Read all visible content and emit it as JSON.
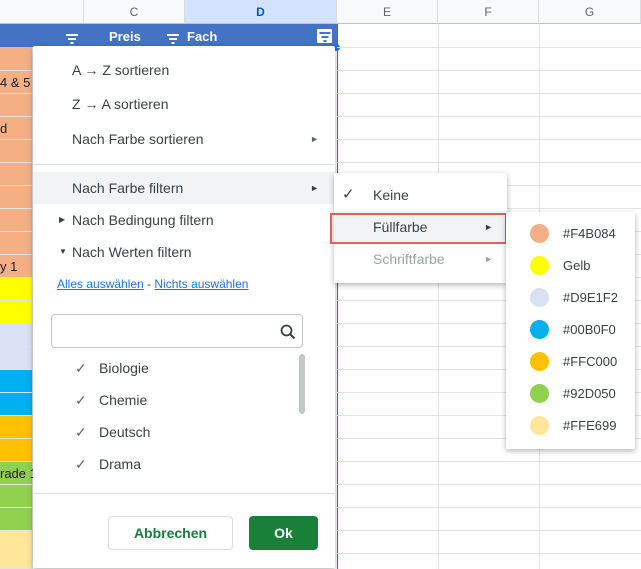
{
  "columns": {
    "c": "C",
    "d": "D",
    "e": "E",
    "f": "F",
    "g": "G"
  },
  "header_row": {
    "preis": "Preis",
    "fach": "Fach"
  },
  "left_cells": [
    "4 & 5",
    "d",
    "y 1",
    "rade 1"
  ],
  "menu": {
    "sort_az": "A → Z sortieren",
    "sort_za": "Z → A sortieren",
    "sort_color": "Nach Farbe sortieren",
    "filter_color": "Nach Farbe filtern",
    "filter_condition": "Nach Bedingung filtern",
    "filter_values": "Nach Werten filtern",
    "select_all": "Alles auswählen",
    "link_sep": " - ",
    "select_none": "Nichts auswählen",
    "search_placeholder": "",
    "values": [
      {
        "label": "Biologie",
        "checked": true
      },
      {
        "label": "Chemie",
        "checked": true
      },
      {
        "label": "Deutsch",
        "checked": true
      },
      {
        "label": "Drama",
        "checked": true
      }
    ],
    "cancel_label": "Abbrechen",
    "ok_label": "Ok"
  },
  "submenu": {
    "none": "Keine",
    "fill": "Füllfarbe",
    "text": "Schriftfarbe"
  },
  "fill_colors": [
    {
      "label": "#F4B084",
      "color": "#F4B084"
    },
    {
      "label": "Gelb",
      "color": "#FFFF00"
    },
    {
      "label": "#D9E1F2",
      "color": "#D9E1F2"
    },
    {
      "label": "#00B0F0",
      "color": "#00B0F0"
    },
    {
      "label": "#FFC000",
      "color": "#FFC000"
    },
    {
      "label": "#92D050",
      "color": "#92D050"
    },
    {
      "label": "#FFE699",
      "color": "#FFE699"
    }
  ]
}
